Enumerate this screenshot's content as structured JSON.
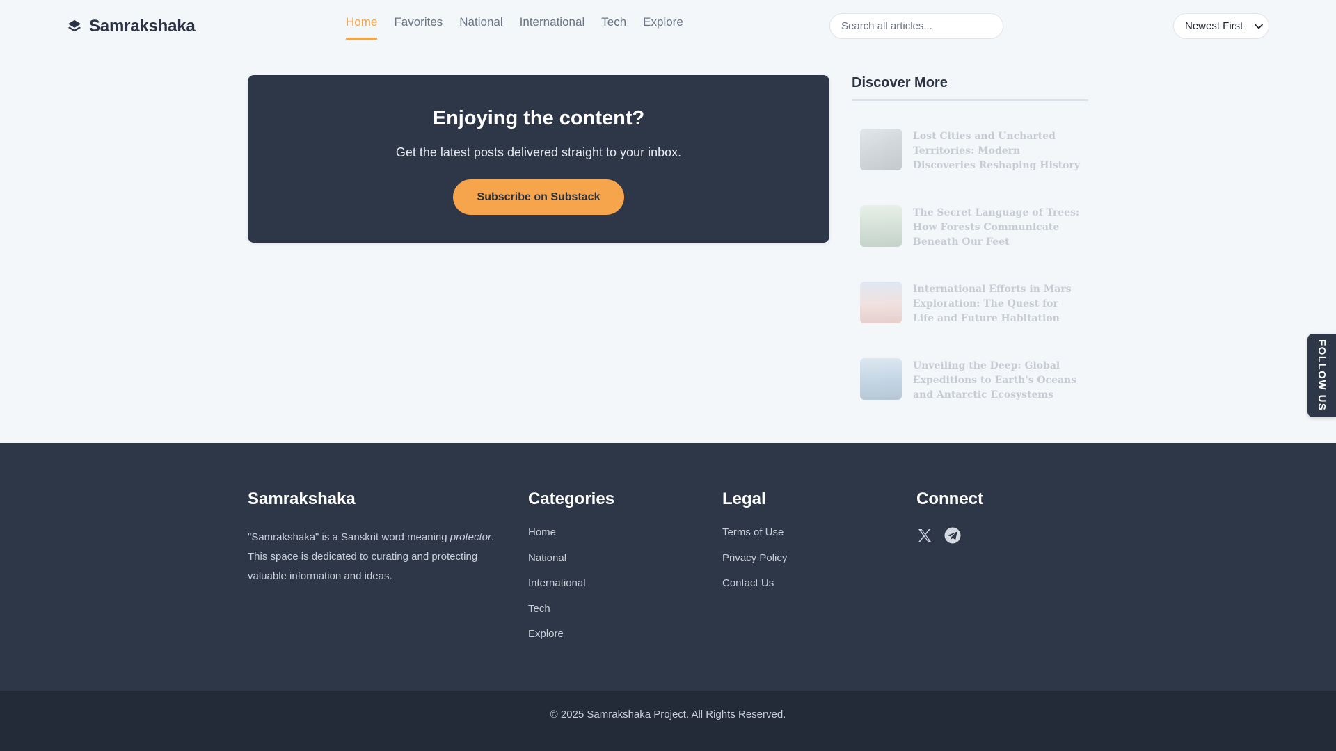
{
  "brand": {
    "name": "Samrakshaka",
    "icon": "layers-icon"
  },
  "nav": {
    "items": [
      {
        "label": "Home",
        "active": true
      },
      {
        "label": "Favorites",
        "active": false
      },
      {
        "label": "National",
        "active": false
      },
      {
        "label": "International",
        "active": false
      },
      {
        "label": "Tech",
        "active": false
      },
      {
        "label": "Explore",
        "active": false
      }
    ]
  },
  "search": {
    "placeholder": "Search all articles...",
    "value": ""
  },
  "sort": {
    "selected": "Newest First",
    "icon": "chevron-down-icon"
  },
  "subscribe": {
    "title": "Enjoying the content?",
    "text": "Get the latest posts delivered straight to your inbox.",
    "button": "Subscribe on Substack"
  },
  "discover": {
    "title": "Discover More",
    "items": [
      {
        "title": "Lost Cities and Uncharted Territories: Modern Discoveries Reshaping History"
      },
      {
        "title": "The Secret Language of Trees: How Forests Communicate Beneath Our Feet"
      },
      {
        "title": "International Efforts in Mars Exploration: The Quest for Life and Future Habitation"
      },
      {
        "title": "Unveiling the Deep: Global Expeditions to Earth's Oceans and Antarctic Ecosystems"
      }
    ]
  },
  "follow": {
    "label": "FOLLOW US"
  },
  "footer": {
    "about": {
      "heading": "Samrakshaka",
      "text_before": "\"Samrakshaka\" is a Sanskrit word meaning ",
      "text_em": "protector",
      "text_after": ". This space is dedicated to curating and protecting valuable information and ideas."
    },
    "categories": {
      "heading": "Categories",
      "links": [
        "Home",
        "National",
        "International",
        "Tech",
        "Explore"
      ]
    },
    "legal": {
      "heading": "Legal",
      "links": [
        "Terms of Use",
        "Privacy Policy",
        "Contact Us"
      ]
    },
    "connect": {
      "heading": "Connect",
      "icons": [
        "x-twitter-icon",
        "telegram-icon"
      ]
    },
    "copyright": "© 2025 Samrakshaka Project. All Rights Reserved."
  },
  "colors": {
    "accent": "#f6a34a",
    "dark": "#2e3748",
    "darker": "#232a38",
    "background": "#f4f7fa"
  }
}
